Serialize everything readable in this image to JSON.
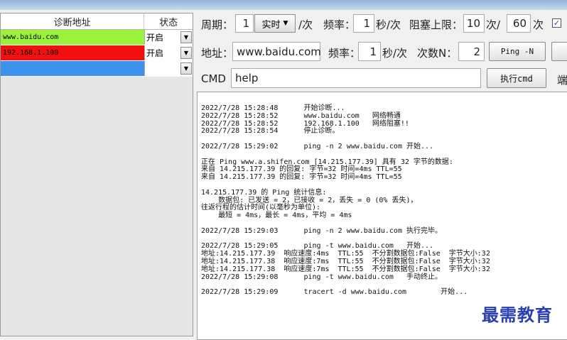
{
  "grid": {
    "headers": {
      "address": "诊断地址",
      "state": "状态"
    },
    "rows": [
      {
        "address": "www.baidu.com",
        "state": "开启",
        "color": "#9cf23a"
      },
      {
        "address": "192.168.1.100",
        "state": "开启",
        "color": "#f20f0f"
      },
      {
        "address": "",
        "state": "",
        "color": "#3c93ee"
      }
    ]
  },
  "controls": {
    "period_label": "周期：",
    "period_value": "1",
    "period_mode": "实时",
    "period_unit": "/次",
    "freq_label": "频率：",
    "freq_value": "1",
    "freq_unit": "秒/次",
    "block_label": "阻塞上限：",
    "block_value": "10",
    "block_unit": "次/",
    "block_value2": "60",
    "block_unit2": "次",
    "checkbox_mark": "✓",
    "addr_label": "地址：",
    "addr_value": "www.baidu.com",
    "freq2_label": "频率：",
    "freq2_value": "1",
    "freq2_unit": "秒/次",
    "count_label": "次数N：",
    "count_value": "2",
    "ping_button": "Ping -N",
    "cmd_label": "CMD",
    "cmd_value": "help",
    "exec_button": "执行cmd",
    "cut_label": "端"
  },
  "log": {
    "lines": [
      "2022/7/28 15:28:48      开始诊断...",
      "2022/7/28 15:28:52      www.baidu.com   网络畅通",
      "2022/7/28 15:28:52      192.168.1.100   网络阻塞!!",
      "2022/7/28 15:28:54      停止诊断。",
      "",
      "2022/7/28 15:29:02      ping -n 2 www.baidu.com 开始...",
      "",
      "正在 Ping www.a.shifen.com [14.215.177.39] 具有 32 字节的数据:",
      "来自 14.215.177.39 的回复: 字节=32 时间=4ms TTL=55",
      "来自 14.215.177.39 的回复: 字节=32 时间=4ms TTL=55",
      "",
      "14.215.177.39 的 Ping 统计信息:",
      "    数据包: 已发送 = 2，已接收 = 2，丢失 = 0 (0% 丢失)，",
      "往返行程的估计时间(以毫秒为单位):",
      "    最短 = 4ms，最长 = 4ms，平均 = 4ms",
      "",
      "2022/7/28 15:29:03      ping -n 2 www.baidu.com 执行完毕。",
      "",
      "2022/7/28 15:29:05      ping -t www.baidu.com   开始...",
      "地址:14.215.177.39  响应速度:4ms  TTL:55  不分割数据包:False  字节大小:32",
      "地址:14.215.177.38  响应速度:7ms  TTL:55  不分割数据包:False  字节大小:32",
      "地址:14.215.177.38  响应速度:7ms  TTL:55  不分割数据包:False  字节大小:32",
      "2022/7/28 15:29:08      ping -t www.baidu.com   手动终止。",
      "",
      "2022/7/28 15:29:09      tracert -d www.baidu.com        开始..."
    ]
  },
  "watermark": "最需教育"
}
